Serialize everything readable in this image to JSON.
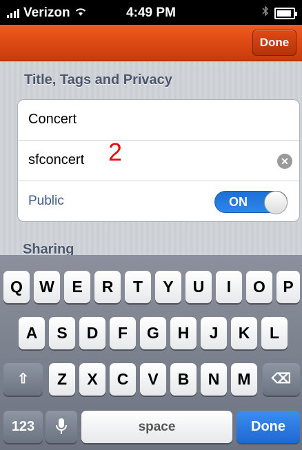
{
  "status_bar": {
    "carrier": "Verizon",
    "time": "4:49 PM"
  },
  "nav": {
    "done_label": "Done"
  },
  "section": {
    "title": "Title, Tags and Privacy"
  },
  "fields": {
    "title_value": "Concert",
    "tags_value": "sfconcert",
    "public_label": "Public",
    "public_toggle": "ON",
    "clear_icon": "✕"
  },
  "annotation": "2",
  "sharing_title": "Sharing",
  "keyboard": {
    "row1": [
      "Q",
      "W",
      "E",
      "R",
      "T",
      "Y",
      "U",
      "I",
      "O",
      "P"
    ],
    "row2": [
      "A",
      "S",
      "D",
      "F",
      "G",
      "H",
      "J",
      "K",
      "L"
    ],
    "row3": [
      "Z",
      "X",
      "C",
      "V",
      "B",
      "N",
      "M"
    ],
    "shift_icon": "⇧",
    "delete_icon": "⌫",
    "numbers_label": "123",
    "mic_icon": "🎙",
    "space_label": "space",
    "done_label": "Done"
  },
  "colors": {
    "nav_orange": "#e0501a",
    "accent_blue": "#1f68d3"
  }
}
